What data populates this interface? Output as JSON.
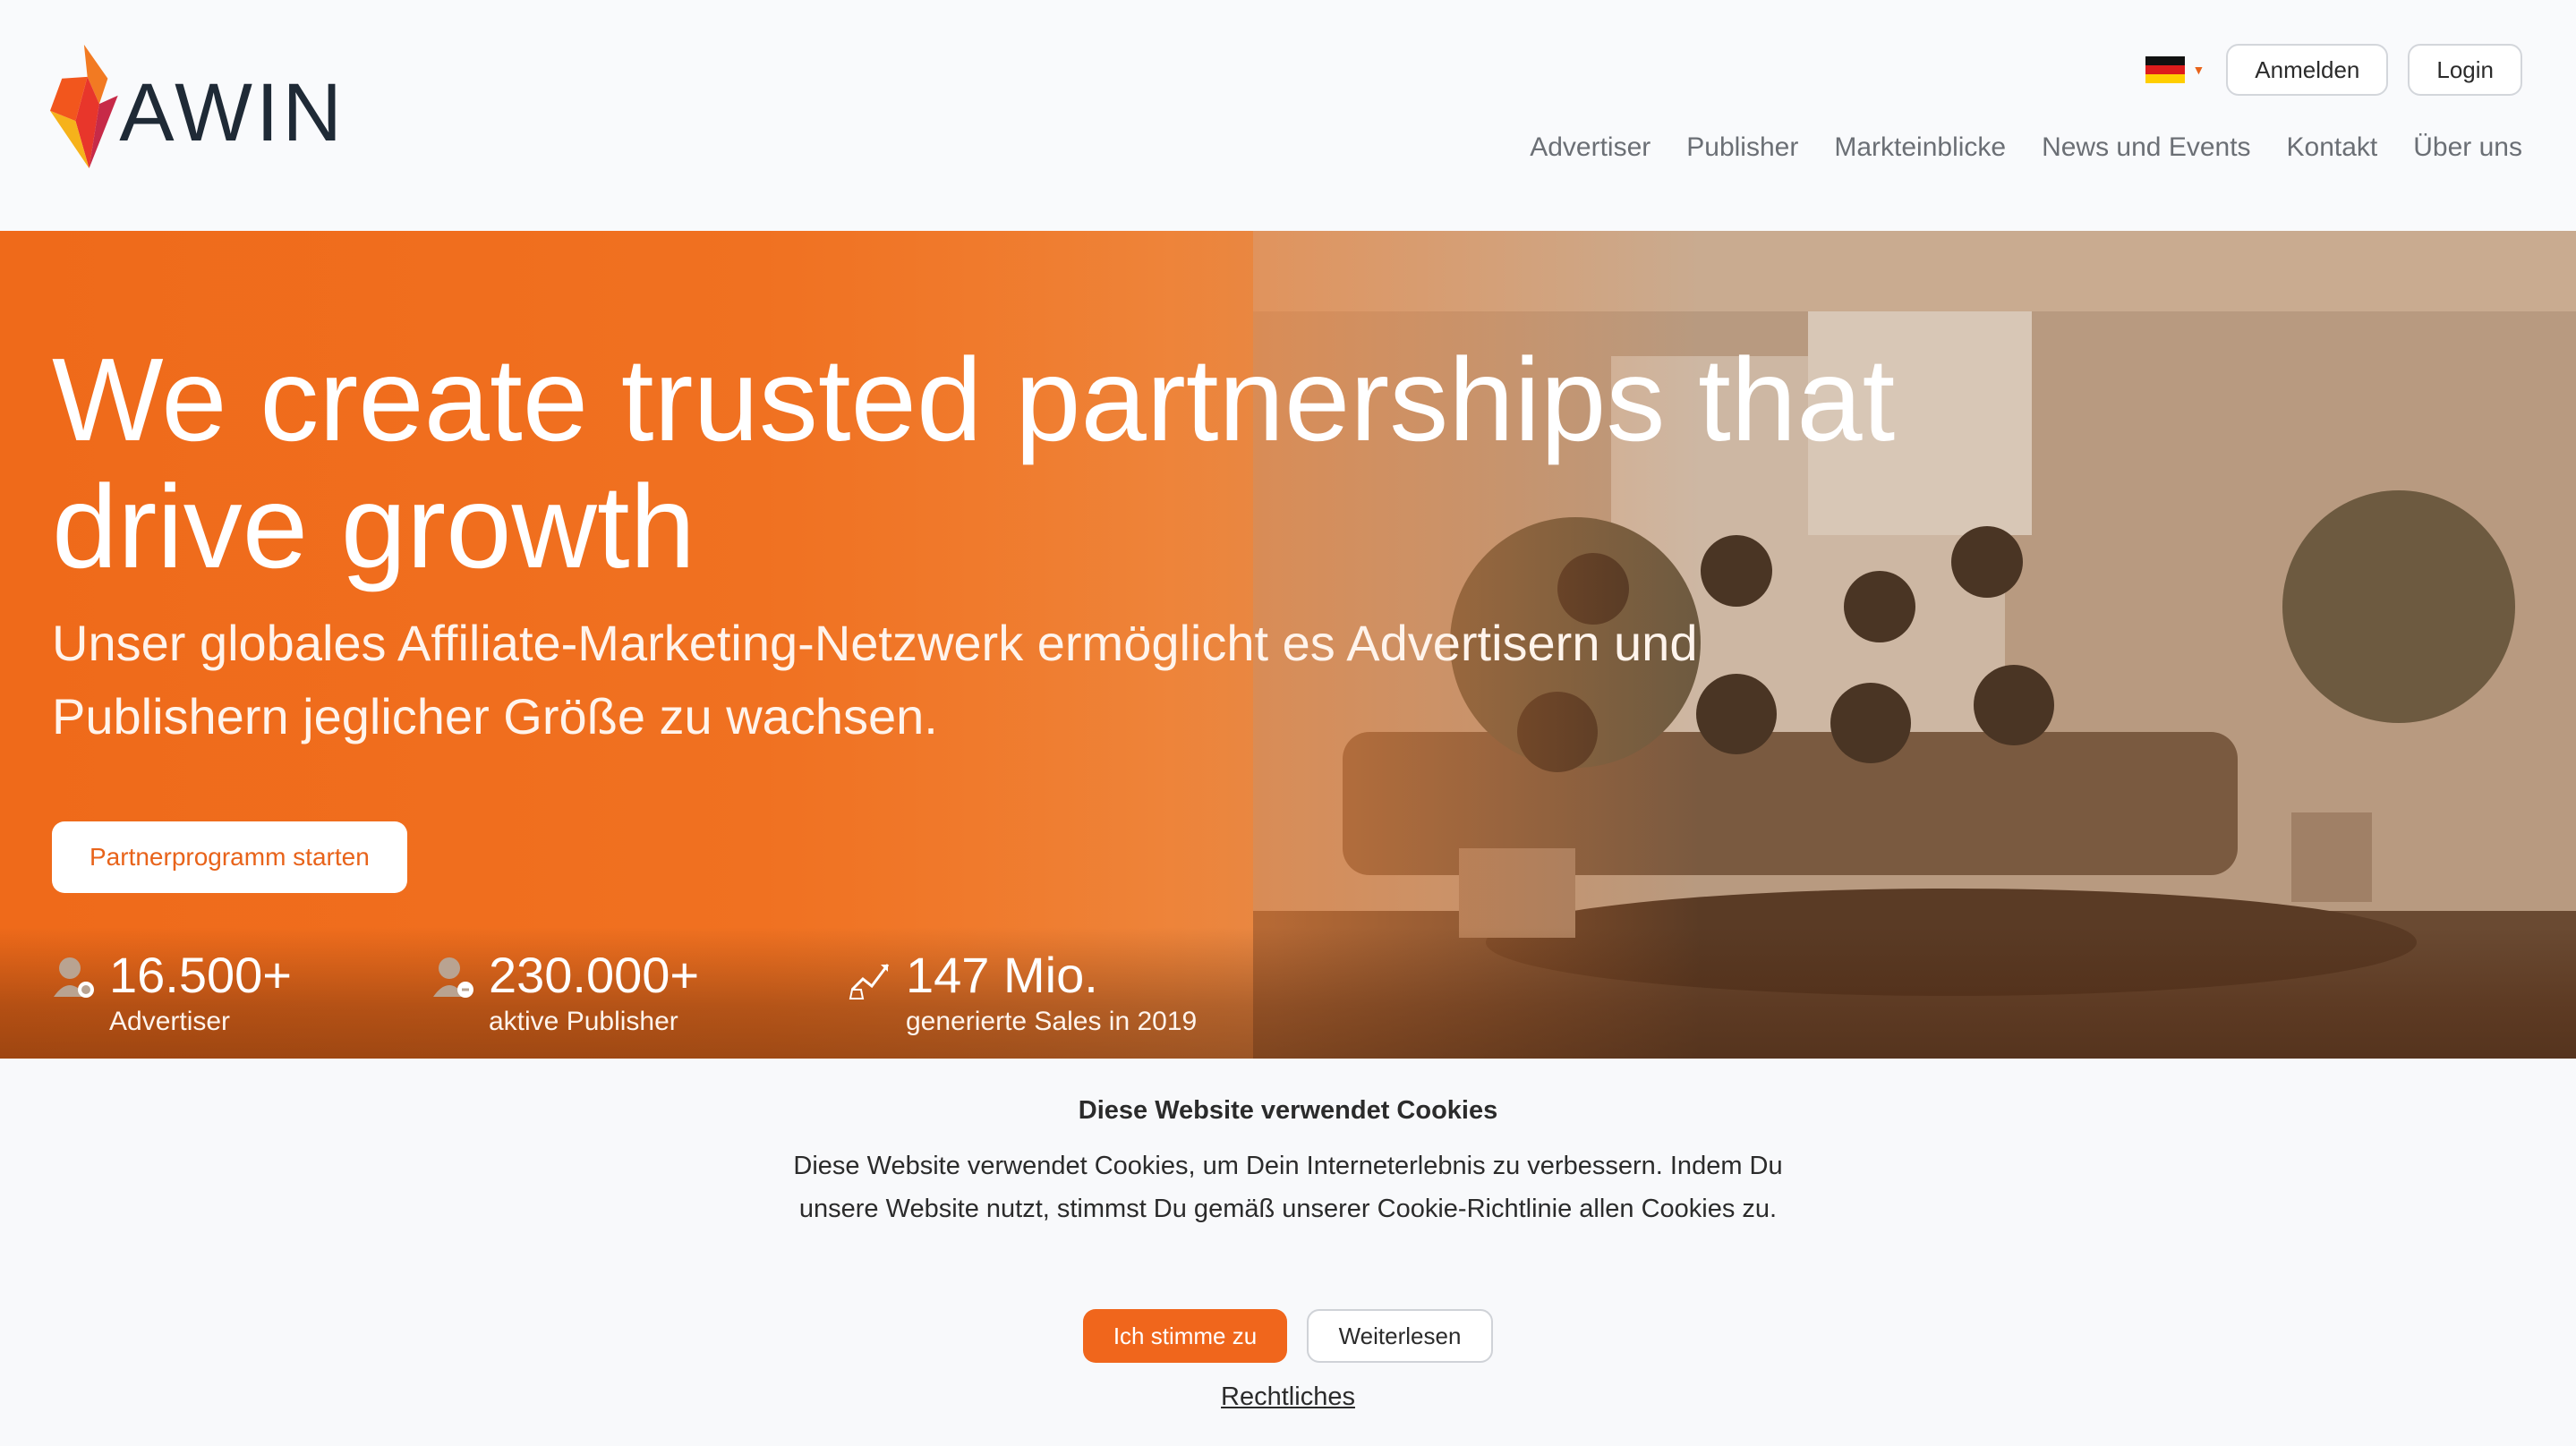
{
  "header": {
    "logo_text": "AWIN",
    "language": "Deutsch",
    "anmelden_label": "Anmelden",
    "login_label": "Login",
    "nav": [
      {
        "label": "Advertiser"
      },
      {
        "label": "Publisher"
      },
      {
        "label": "Markteinblicke"
      },
      {
        "label": "News und Events"
      },
      {
        "label": "Kontakt"
      },
      {
        "label": "Über uns"
      }
    ]
  },
  "hero": {
    "title": "We create trusted partnerships that drive growth",
    "subtitle": "Unser globales Affiliate-Marketing-Netzwerk ermöglicht es Advertisern und Publishern jeglicher Größe zu wachsen.",
    "cta_label": "Partnerprogramm starten",
    "stats": [
      {
        "value": "16.500+",
        "label": "Advertiser",
        "icon": "advertiser-icon"
      },
      {
        "value": "230.000+",
        "label": "aktive Publisher",
        "icon": "publisher-icon"
      },
      {
        "value": "147 Mio.",
        "label": "generierte Sales in 2019",
        "icon": "sales-chart-icon"
      }
    ]
  },
  "cookie": {
    "title": "Diese Website verwendet Cookies",
    "text": "Diese Website verwendet Cookies, um Dein Interneterlebnis zu verbessern. Indem Du unsere Website nutzt, stimmst Du gemäß unserer Cookie-Richtlinie allen Cookies zu.",
    "accept_label": "Ich stimme zu",
    "more_label": "Weiterlesen",
    "legal_label": "Rechtliches"
  },
  "colors": {
    "brand_orange": "#f0661c",
    "text_dark": "#2b2b2b",
    "nav_grey": "#6b6f75"
  }
}
